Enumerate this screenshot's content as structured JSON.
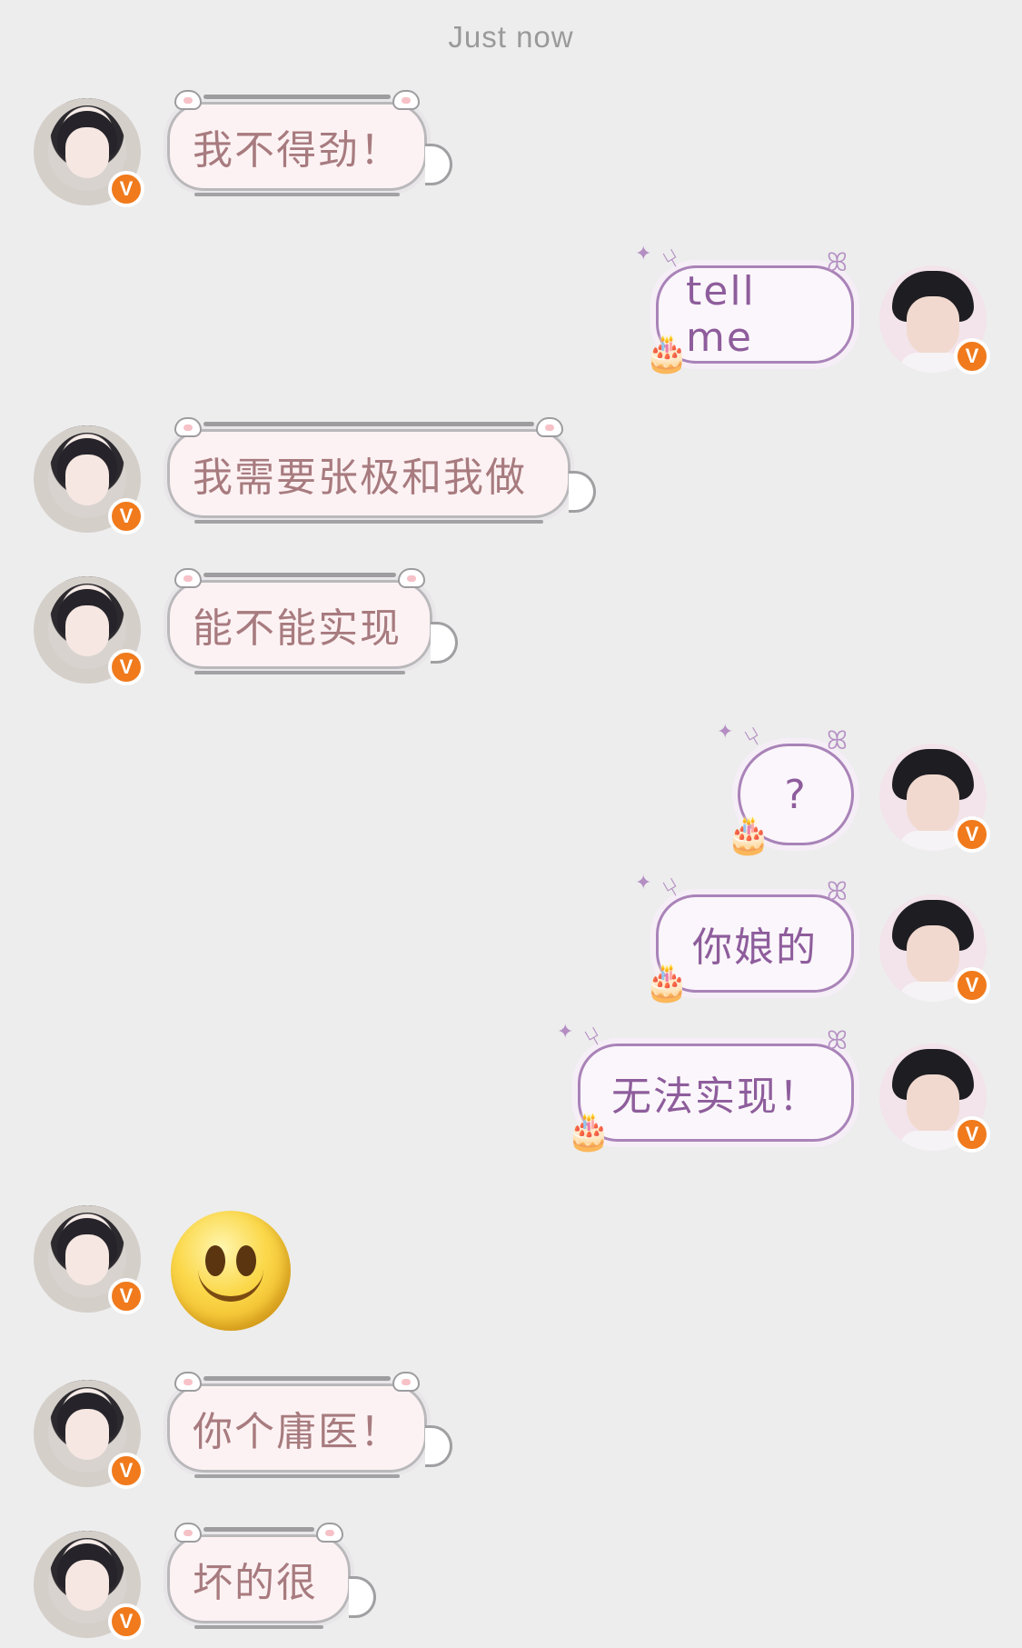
{
  "timestamp": "Just now",
  "messages": [
    {
      "from": "them",
      "text": "我不得劲！"
    },
    {
      "from": "me",
      "text": "tell me"
    },
    {
      "from": "them",
      "text": "我需要张极和我做"
    },
    {
      "from": "them",
      "text": "能不能实现"
    },
    {
      "from": "me",
      "text": "?"
    },
    {
      "from": "me",
      "text": "你娘的"
    },
    {
      "from": "me",
      "text": "无法实现！"
    },
    {
      "from": "them",
      "type": "emoji",
      "emoji": "smiley-emoji"
    },
    {
      "from": "them",
      "text": "你个庸医！"
    },
    {
      "from": "them",
      "text": "坏的很"
    }
  ],
  "badge_label": "V",
  "colors": {
    "background": "#ededed",
    "incoming_text": "#a77b7f",
    "outgoing_text": "#8e5d9c",
    "verified_badge": "#f07a1c"
  }
}
